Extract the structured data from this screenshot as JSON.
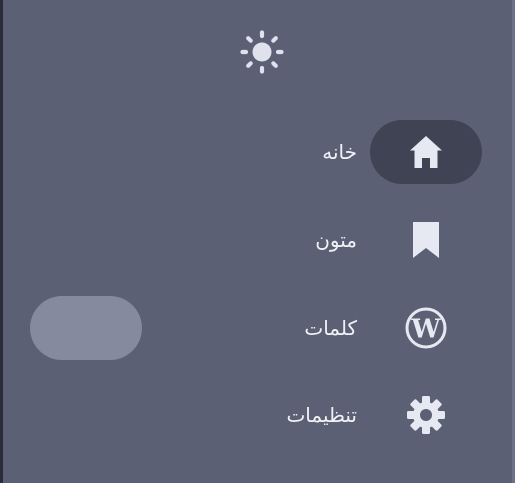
{
  "colors": {
    "panel": "#5b6074",
    "active_pill": "#3f4354",
    "extra_pill": "#858a9e",
    "icon": "#e6e8f2",
    "text": "#f1f2f7"
  },
  "header": {
    "theme_icon": "sun-icon"
  },
  "nav": {
    "items": [
      {
        "label": "خانه",
        "icon": "home-icon",
        "active": true
      },
      {
        "label": "متون",
        "icon": "bookmark-icon",
        "active": false
      },
      {
        "label": "کلمات",
        "icon": "wordpress-icon",
        "active": false
      },
      {
        "label": "تنظیمات",
        "icon": "gear-icon",
        "active": false
      }
    ]
  }
}
